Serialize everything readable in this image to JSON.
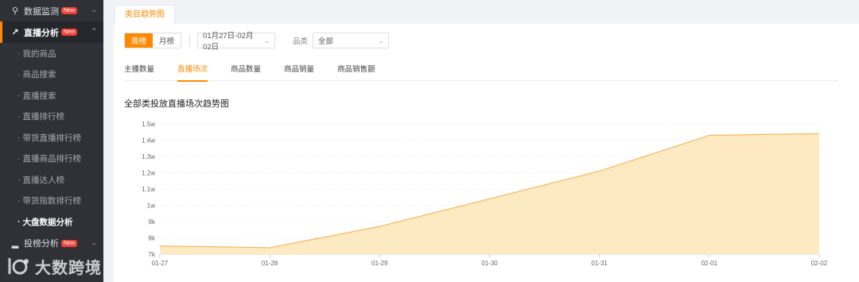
{
  "sidebar": {
    "groups": [
      {
        "label": "数据监测",
        "badge": "New",
        "icon": "search-icon"
      },
      {
        "label": "直播分析",
        "badge": "New",
        "icon": "trend-icon",
        "active": true
      },
      {
        "label": "投榜分析",
        "badge": "New",
        "icon": "bar-chart-icon"
      }
    ],
    "items": [
      "我的商品",
      "商品搜索",
      "直播搜索",
      "直播排行榜",
      "带货直播排行榜",
      "直播商品排行榜",
      "直播达人榜",
      "带货指数排行榜",
      "大盘数据分析"
    ],
    "current_item": "大盘数据分析"
  },
  "watermark": {
    "text": "大数跨境"
  },
  "page_tab": "类目趋势图",
  "filters": {
    "period": {
      "options": [
        "周榜",
        "月榜"
      ],
      "selected": "周榜"
    },
    "date_range": "01月27日-02月02日",
    "category_label": "品类",
    "category_value": "全部"
  },
  "metric_tabs": {
    "options": [
      "主播数量",
      "直播场次",
      "商品数量",
      "商品销量",
      "商品销售额"
    ],
    "selected": "直播场次"
  },
  "chart_title": "全部类投放直播场次趋势图",
  "colors": {
    "accent": "#ff8a00",
    "area_fill": "#fdeac3",
    "area_line": "#f5b75b"
  },
  "chart_data": {
    "type": "area",
    "x": [
      "01-27",
      "01-28",
      "01-29",
      "01-30",
      "01-31",
      "02-01",
      "02-02"
    ],
    "values": [
      7500,
      7400,
      8700,
      10400,
      12100,
      14300,
      14400
    ],
    "y_ticks": [
      "7k",
      "8k",
      "9k",
      "1w",
      "1.1w",
      "1.2w",
      "1.3w",
      "1.4w",
      "1.5w"
    ],
    "ylim": [
      7000,
      15000
    ],
    "grid": true,
    "legend": "none"
  }
}
